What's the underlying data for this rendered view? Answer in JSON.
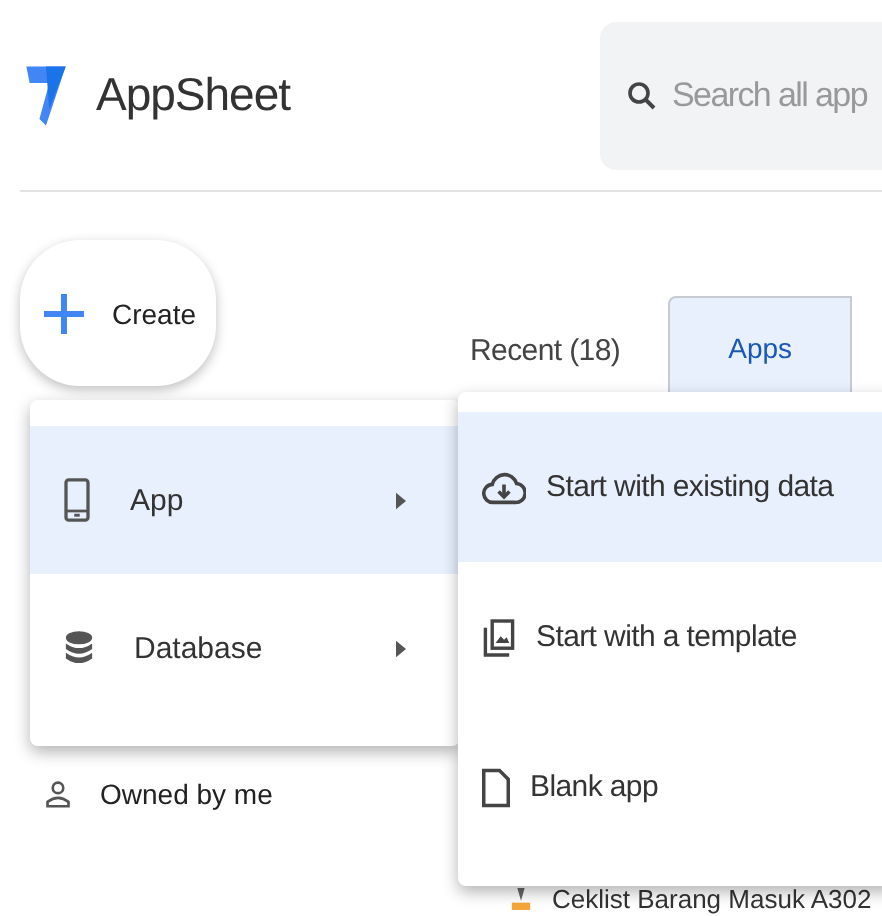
{
  "header": {
    "app_name": "AppSheet",
    "search": {
      "placeholder": "Search all app"
    }
  },
  "create_button": {
    "label": "Create"
  },
  "recent_label": "Recent (18)",
  "tabs": [
    {
      "label": "Apps",
      "selected": true
    }
  ],
  "sidebar": {
    "items": [
      {
        "label": "Owned by me",
        "kind": "person"
      }
    ]
  },
  "create_menu": {
    "items": [
      {
        "label": "App",
        "kind": "phone",
        "selected": true
      },
      {
        "label": "Database",
        "kind": "database",
        "selected": false
      }
    ]
  },
  "submenu": {
    "items": [
      {
        "label": "Start with existing data",
        "kind": "cloud",
        "selected": true
      },
      {
        "label": "Start with a template",
        "kind": "template",
        "selected": false
      },
      {
        "label": "Blank app",
        "kind": "file",
        "selected": false
      }
    ]
  },
  "app_list": [
    {
      "name": "Ceklist Barang Masuk A302"
    }
  ]
}
